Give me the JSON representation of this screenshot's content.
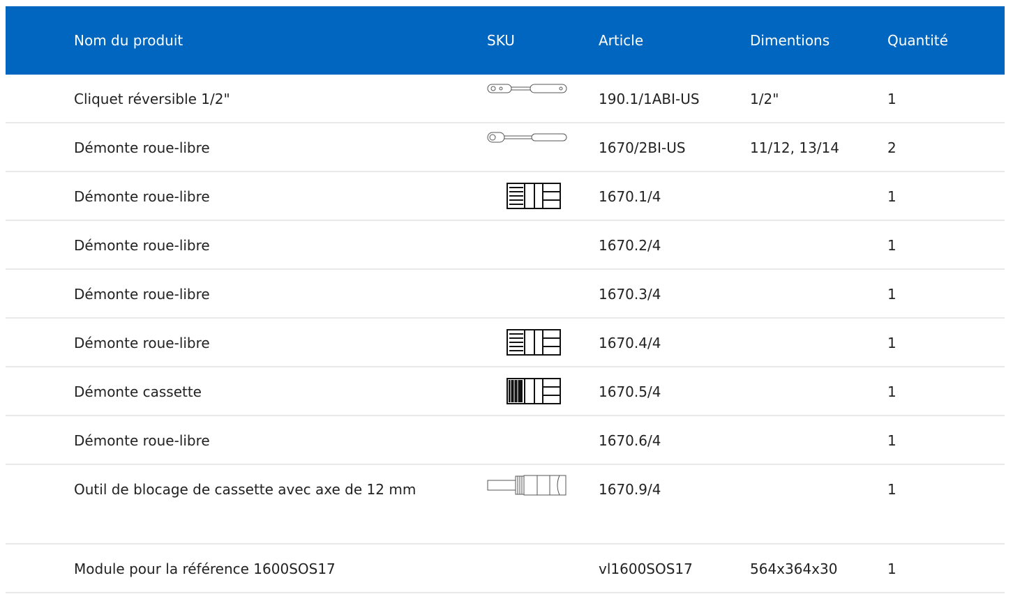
{
  "headers": {
    "name": "Nom du produit",
    "sku": "SKU",
    "article": "Article",
    "dimensions": "Dimentions",
    "quantity": "Quantité"
  },
  "colors": {
    "header_bg": "#0066bf",
    "header_text": "#ffffff",
    "row_border": "#e9e9e9"
  },
  "rows": [
    {
      "name": "Cliquet réversible 1/2\"",
      "icon": "ratchet-icon",
      "article": "190.1/1ABI-US",
      "dimensions": "1/2\"",
      "quantity": "1"
    },
    {
      "name": "Démonte roue-libre",
      "icon": "ratchet-icon",
      "article": "1670/2BI-US",
      "dimensions": "11/12, 13/14",
      "quantity": "2"
    },
    {
      "name": "Démonte roue-libre",
      "icon": "freewheel-tool-icon",
      "article": "1670.1/4",
      "dimensions": "",
      "quantity": "1"
    },
    {
      "name": "Démonte roue-libre",
      "icon": "",
      "article": "1670.2/4",
      "dimensions": "",
      "quantity": "1"
    },
    {
      "name": "Démonte roue-libre",
      "icon": "",
      "article": "1670.3/4",
      "dimensions": "",
      "quantity": "1"
    },
    {
      "name": "Démonte roue-libre",
      "icon": "freewheel-tool-icon",
      "article": "1670.4/4",
      "dimensions": "",
      "quantity": "1"
    },
    {
      "name": "Démonte cassette",
      "icon": "cassette-tool-icon",
      "article": "1670.5/4",
      "dimensions": "",
      "quantity": "1"
    },
    {
      "name": "Démonte roue-libre",
      "icon": "",
      "article": "1670.6/4",
      "dimensions": "",
      "quantity": "1"
    },
    {
      "name": "Outil de blocage de cassette avec axe de 12 mm",
      "icon": "cassette-lockring-tool-icon",
      "article": "1670.9/4",
      "dimensions": "",
      "quantity": "1"
    },
    {
      "name": "Module pour la référence 1600SOS17",
      "icon": "",
      "article": "vl1600SOS17",
      "dimensions": "564x364x30",
      "quantity": "1"
    }
  ]
}
